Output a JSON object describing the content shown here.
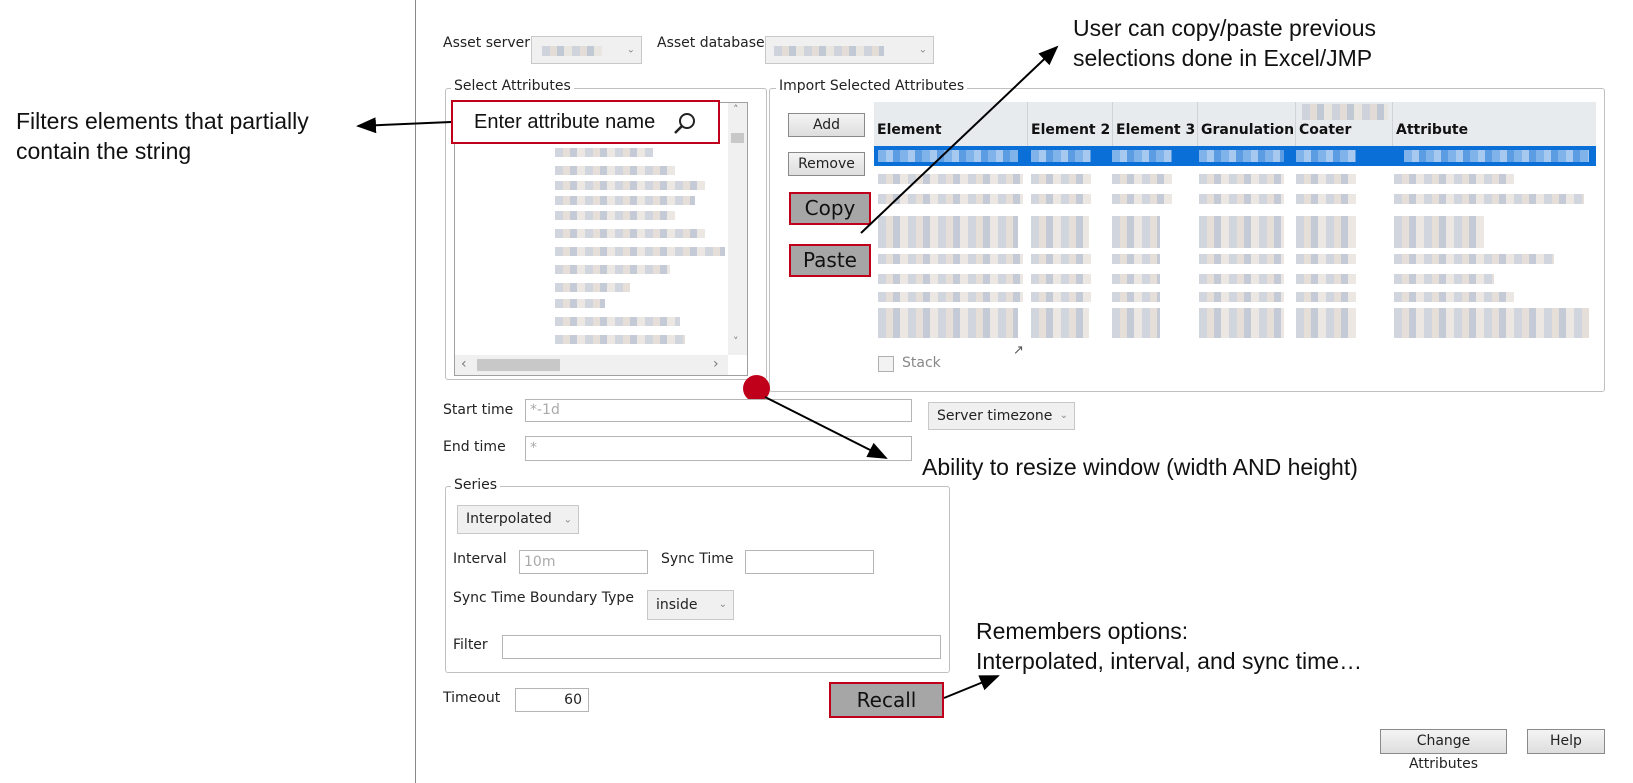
{
  "dialog": {
    "asset_server_label": "Asset server",
    "asset_database_label": "Asset database",
    "select_attributes_title": "Select Attributes",
    "search_placeholder": "Enter attribute name",
    "import_title": "Import Selected Attributes",
    "add_label": "Add",
    "remove_label": "Remove",
    "copy_label": "Copy",
    "paste_label": "Paste",
    "columns": [
      "Element",
      "Element 2",
      "Element 3",
      "Granulation",
      "Coater",
      "Attribute"
    ],
    "stack_label": "Stack",
    "start_time_label": "Start time",
    "start_time_value": "*-1d",
    "end_time_label": "End time",
    "end_time_value": "*",
    "timezone_value": "Server timezone",
    "series_title": "Series",
    "series_mode_value": "Interpolated",
    "interval_label": "Interval",
    "interval_value": "10m",
    "sync_time_label": "Sync Time",
    "sync_boundary_label": "Sync Time Boundary Type",
    "sync_boundary_value": "inside",
    "filter_label": "Filter",
    "timeout_label": "Timeout",
    "timeout_value": "60",
    "recall_label": "Recall",
    "change_attributes_label": "Change Attributes",
    "help_label": "Help"
  },
  "annotations": {
    "filter_note_line1": "Filters elements that partially",
    "filter_note_line2": "contain the string",
    "copy_note_line1": "User can copy/paste previous",
    "copy_note_line2": "selections done in Excel/JMP",
    "resize_note": "Ability to resize window (width AND height)",
    "recall_note_line1": "Remembers options:",
    "recall_note_line2": "Interpolated, interval, and sync time…"
  },
  "colors": {
    "highlight_red": "#c0001a",
    "selection_blue": "#0a6fd6",
    "button_gray": "#a6a6a6"
  }
}
